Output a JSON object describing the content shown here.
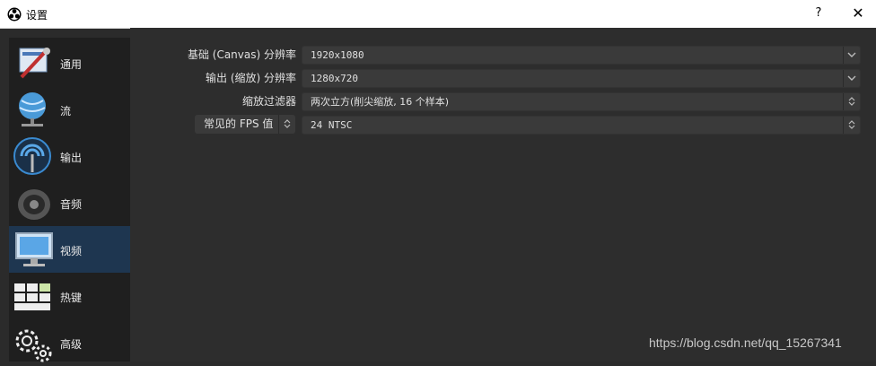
{
  "window": {
    "title": "设置",
    "help_label": "?",
    "close_label": "✕"
  },
  "sidebar": {
    "items": [
      {
        "label": "通用",
        "icon": "general-settings-icon"
      },
      {
        "label": "流",
        "icon": "stream-globe-icon"
      },
      {
        "label": "输出",
        "icon": "output-broadcast-icon"
      },
      {
        "label": "音频",
        "icon": "speaker-icon"
      },
      {
        "label": "视频",
        "icon": "monitor-icon",
        "selected": true
      },
      {
        "label": "热键",
        "icon": "keyboard-icon"
      },
      {
        "label": "高级",
        "icon": "gears-icon"
      }
    ]
  },
  "video": {
    "base_resolution": {
      "label": "基础 (Canvas) 分辨率",
      "value": "1920x1080"
    },
    "output_resolution": {
      "label": "输出 (缩放) 分辨率",
      "value": "1280x720"
    },
    "downscale_filter": {
      "label": "缩放过滤器",
      "value": "两次立方(削尖缩放, 16 个样本)"
    },
    "fps": {
      "type_label": "常见的 FPS 值",
      "value": "24 NTSC"
    }
  },
  "watermark": "https://blog.csdn.net/qq_15267341",
  "colors": {
    "selected_bg": "#1e3650",
    "panel_bg": "#2d2d2d",
    "sidebar_bg": "#1f1f1f"
  }
}
